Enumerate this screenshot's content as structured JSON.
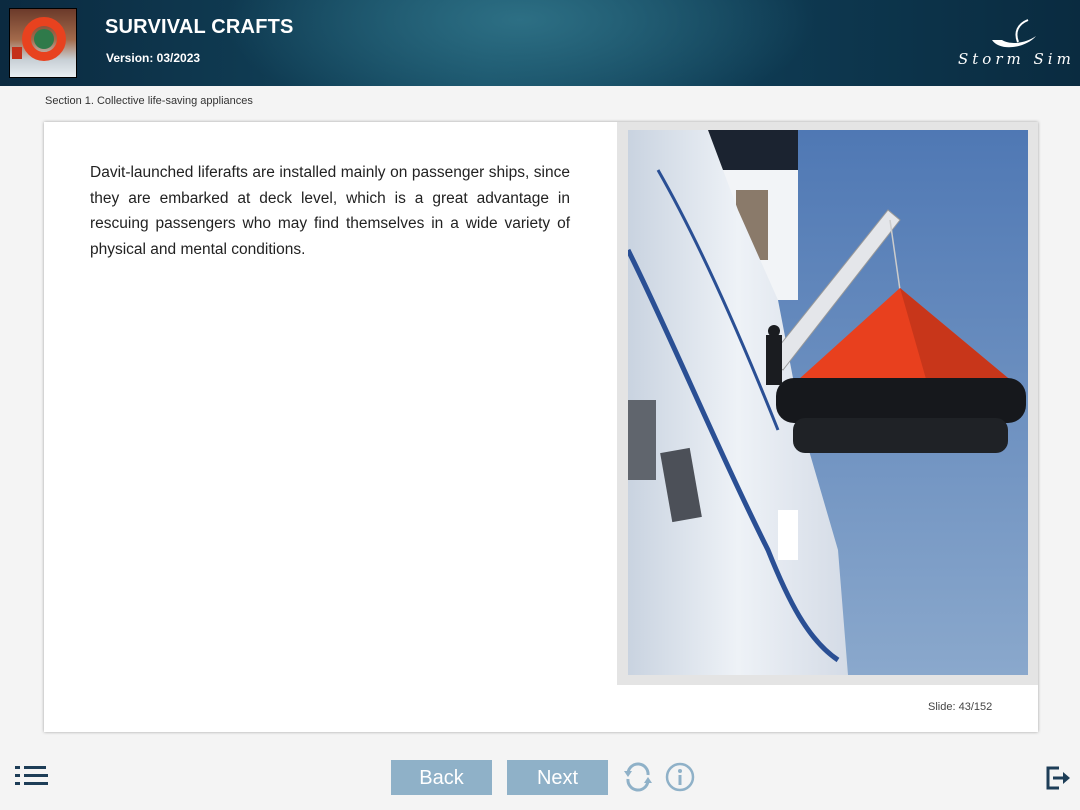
{
  "header": {
    "title": "SURVIVAL CRAFTS",
    "version": "Version: 03/2023",
    "brand": "Storm Sim"
  },
  "section": "Section 1. Collective life-saving appliances",
  "content": {
    "paragraph": "Davit-launched liferafts are installed mainly on passenger ships, since they are embarked at deck level, which is a great advantage in rescuing passengers who may find themselves in a wide variety of physical and mental conditions."
  },
  "slide": {
    "label": "Slide:",
    "counter": "43/152"
  },
  "nav": {
    "back": "Back",
    "next": "Next"
  },
  "icons": {
    "menu": "list-icon",
    "reload": "reload-icon",
    "info": "info-icon",
    "exit": "exit-icon"
  },
  "colors": {
    "header_dark": "#0b2a40",
    "button": "#8fb1c8",
    "icon_dark": "#1d3d57"
  }
}
